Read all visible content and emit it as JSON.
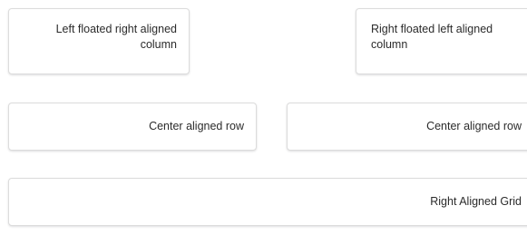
{
  "segments": {
    "left_floated": "Left floated right aligned column",
    "right_floated": "Right floated left aligned column",
    "center_row_1": "Center aligned row",
    "center_row_2": "Center aligned row",
    "right_grid": "Right Aligned Grid"
  }
}
